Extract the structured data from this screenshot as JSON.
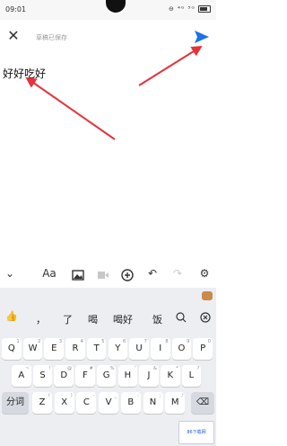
{
  "status": {
    "time": "09:01",
    "icons": "⊖ ⁴ᴳ ⁵ᴳ"
  },
  "header": {
    "saved_label": "草稿已保存"
  },
  "content": {
    "text": "好好吃好"
  },
  "toolbar": {
    "font_label": "Aa"
  },
  "candidates": [
    "，",
    "了",
    "喝",
    "喝好",
    "饭"
  ],
  "keyboard": {
    "row1": [
      {
        "k": "Q",
        "s": "1"
      },
      {
        "k": "W",
        "s": "2"
      },
      {
        "k": "E",
        "s": "3"
      },
      {
        "k": "R",
        "s": "4"
      },
      {
        "k": "T",
        "s": "5"
      },
      {
        "k": "Y",
        "s": "6"
      },
      {
        "k": "U",
        "s": "7"
      },
      {
        "k": "I",
        "s": "8"
      },
      {
        "k": "O",
        "s": "9"
      },
      {
        "k": "P",
        "s": "0"
      }
    ],
    "row2": [
      {
        "k": "A",
        "s": "~"
      },
      {
        "k": "S",
        "s": "!"
      },
      {
        "k": "D",
        "s": "@"
      },
      {
        "k": "F",
        "s": "#"
      },
      {
        "k": "G",
        "s": "%"
      },
      {
        "k": "H",
        "s": "'"
      },
      {
        "k": "J",
        "s": "&"
      },
      {
        "k": "K",
        "s": "*"
      },
      {
        "k": "L",
        "s": "?"
      }
    ],
    "row3_left": "分词",
    "row3": [
      {
        "k": "Z",
        "s": "("
      },
      {
        "k": "X",
        "s": ")"
      },
      {
        "k": "C",
        "s": "-"
      },
      {
        "k": "V",
        "s": "_"
      },
      {
        "k": "B",
        "s": ":"
      },
      {
        "k": "N",
        "s": ";"
      },
      {
        "k": "M",
        "s": "/"
      }
    ]
  },
  "watermark": "86下载网",
  "colors": {
    "accent": "#1a73e8",
    "arrow": "#e5323b"
  }
}
